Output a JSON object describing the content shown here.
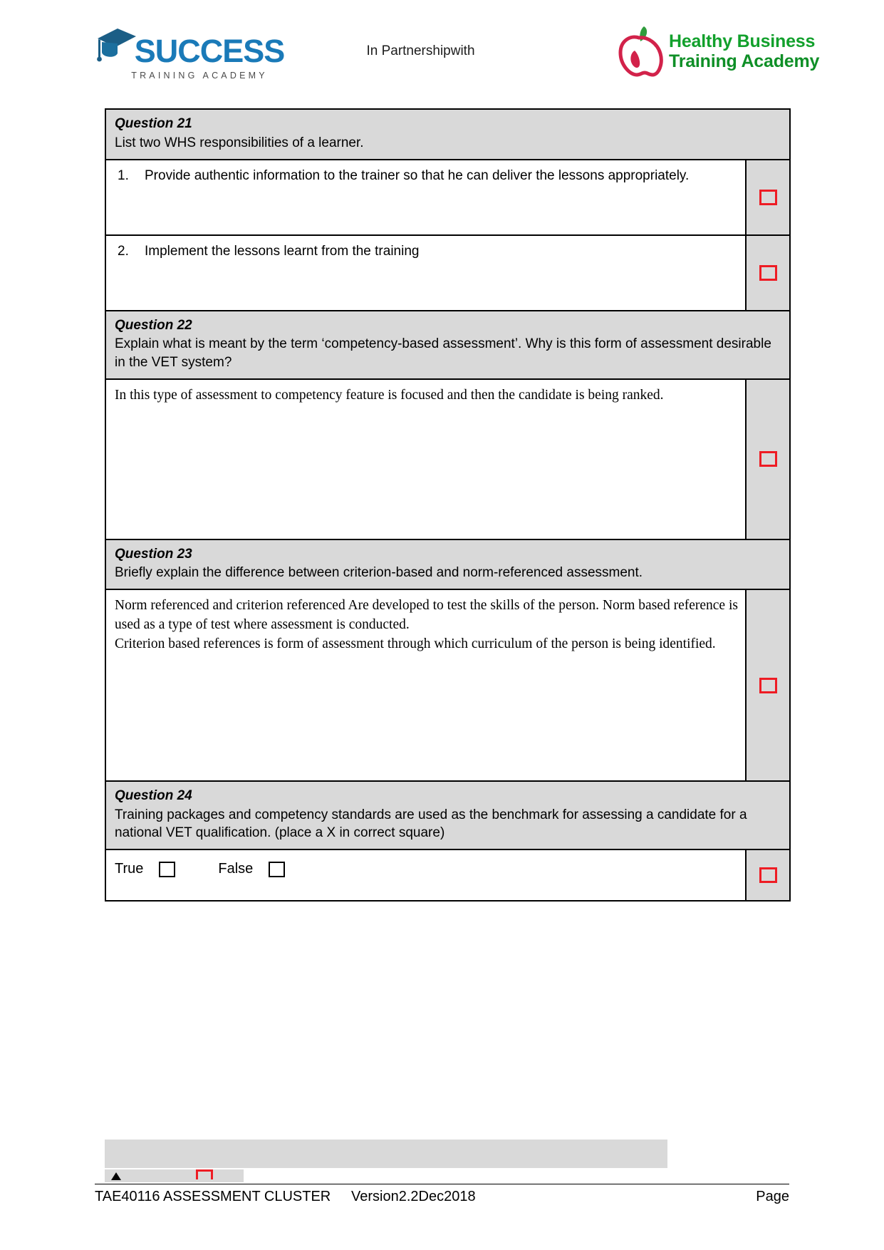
{
  "header": {
    "logo_success": {
      "wordmark": "SUCCESS",
      "subtitle": "TRAINING ACADEMY",
      "color": "#1a7ab8",
      "cap_color": "#1b5e86"
    },
    "partnership_text": "In Partnershipwith",
    "logo_hbta": {
      "line1": "Healthy Business",
      "line2": "Training Academy",
      "color": "#12a02c",
      "apple_color": "#d2224a",
      "leaf_color": "#2f9c3c"
    }
  },
  "questions": [
    {
      "title": "Question 21",
      "prompt": "List two WHS responsibilities of a learner.",
      "answers": [
        {
          "number": "1.",
          "text": "Provide authentic information to the trainer so that he can deliver the lessons appropriately.",
          "mark_checkbox": "unchecked"
        },
        {
          "number": "2.",
          "text": "Implement the lessons learnt from the training",
          "mark_checkbox": "unchecked"
        }
      ]
    },
    {
      "title": "Question 22",
      "prompt": "Explain what is meant by the term ‘competency-based assessment’. Why is this form of assessment desirable in the VET system?",
      "answer_text": "In this type of assessment to competency feature is focused and then the candidate is being ranked.",
      "mark_checkbox": "unchecked"
    },
    {
      "title": "Question 23",
      "prompt": "Briefly explain the difference between criterion-based and norm-referenced assessment.",
      "answer_lines": [
        "Norm referenced and criterion referenced Are developed to test the skills of the person. Norm based reference is used as a type of test where assessment is conducted.",
        "Criterion based references is form of assessment through which curriculum of the person is being identified."
      ],
      "mark_checkbox": "unchecked"
    },
    {
      "title": "Question 24",
      "prompt": "Training packages and competency standards are used as the benchmark for assessing a candidate for a national VET qualification. (place a X in correct square)",
      "options": [
        {
          "label": "True",
          "state": "unchecked"
        },
        {
          "label": "False",
          "state": "unchecked"
        }
      ],
      "mark_checkbox": "unchecked"
    }
  ],
  "footer": {
    "left": "TAE40116 ASSESSMENT CLUSTER",
    "middle": "Version2.2Dec2018",
    "right": "Page"
  },
  "colors": {
    "header_fill": "#d9d9d9",
    "mark_column_fill": "#d9d9d9",
    "red_checkbox": "#ee1c24",
    "border": "#000000"
  }
}
